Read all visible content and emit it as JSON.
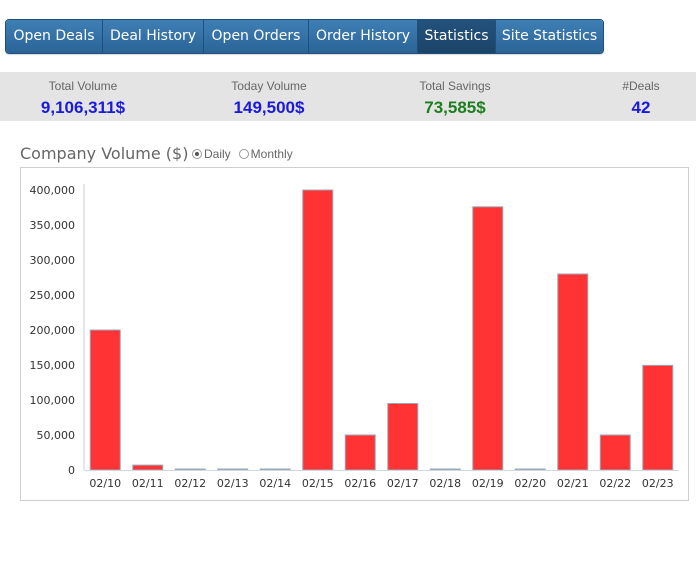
{
  "nav": {
    "tabs": [
      {
        "label": "Open Deals",
        "active": false
      },
      {
        "label": "Deal History",
        "active": false
      },
      {
        "label": "Open Orders",
        "active": false
      },
      {
        "label": "Order History",
        "active": false
      },
      {
        "label": "Statistics",
        "active": true
      },
      {
        "label": "Site Statistics",
        "active": false
      }
    ]
  },
  "stats": {
    "total_volume": {
      "label": "Total Volume",
      "value": "9,106,311$",
      "color": "#1a1ad8"
    },
    "today_volume": {
      "label": "Today Volume",
      "value": "149,500$",
      "color": "#1a1ad8"
    },
    "total_savings": {
      "label": "Total Savings",
      "value": "73,585$",
      "color": "#1e7d1e"
    },
    "deals": {
      "label": "#Deals",
      "value": "42",
      "color": "#1a1ad8"
    }
  },
  "chart_header": {
    "title": "Company Volume ($)",
    "options": [
      {
        "label": "Daily",
        "checked": true
      },
      {
        "label": "Monthly",
        "checked": false
      }
    ]
  },
  "chart_data": {
    "type": "bar",
    "title": "Company Volume ($)",
    "categories": [
      "02/10",
      "02/11",
      "02/12",
      "02/13",
      "02/14",
      "02/15",
      "02/16",
      "02/17",
      "02/18",
      "02/19",
      "02/20",
      "02/21",
      "02/22",
      "02/23"
    ],
    "values": [
      200000,
      7000,
      0,
      0,
      0,
      400000,
      50000,
      95000,
      0,
      376000,
      0,
      280000,
      50000,
      149500
    ],
    "yticks": [
      0,
      50000,
      100000,
      150000,
      200000,
      250000,
      300000,
      350000,
      400000
    ],
    "ytick_labels": [
      "0",
      "50,000",
      "100,000",
      "150,000",
      "200,000",
      "250,000",
      "300,000",
      "350,000",
      "400,000"
    ],
    "ylim": [
      0,
      400000
    ],
    "bar_color": "#ff3333",
    "bar_border": "#9aaabb",
    "grid": false,
    "xlabel": "",
    "ylabel": ""
  }
}
